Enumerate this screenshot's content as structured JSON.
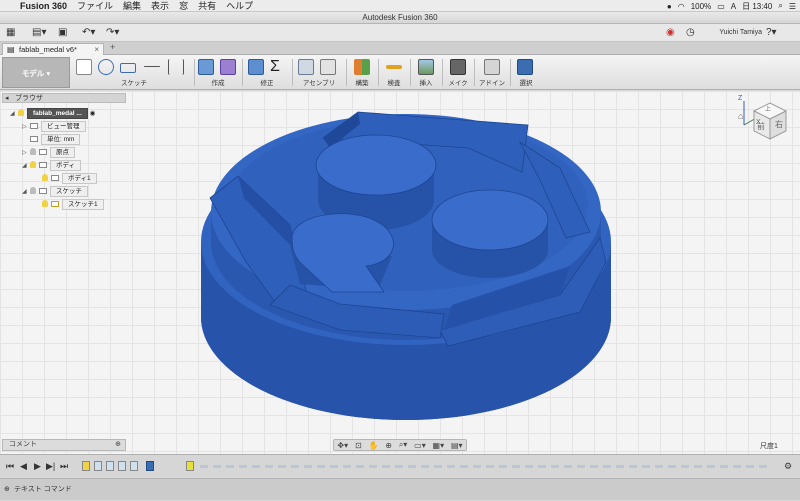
{
  "menubar": {
    "apple": "",
    "app_name": "Fusion 360",
    "items": [
      "ファイル",
      "編集",
      "表示",
      "窓",
      "共有",
      "ヘルプ"
    ],
    "battery": "100%",
    "ime": "A",
    "clock": "日 13:40"
  },
  "window": {
    "title": "Autodesk Fusion 360"
  },
  "qat": {
    "user": "Yuichi Tamiya"
  },
  "doc_tab": {
    "name": "fablab_medal v6*",
    "close": "×"
  },
  "ribbon": {
    "workspace": "モデル",
    "groups": [
      "スケッチ",
      "作成",
      "修正",
      "アセンブリ",
      "構築",
      "検査",
      "挿入",
      "メイク",
      "アドイン",
      "選択"
    ]
  },
  "browser": {
    "title": "ブラウザ",
    "root": "fablab_medal ...",
    "items": [
      "ビュー管理",
      "単位: mm",
      "原点",
      "ボディ",
      "ボディ1",
      "スケッチ",
      "スケッチ1"
    ]
  },
  "viewcube": {
    "left": "前",
    "right": "右",
    "top": "上",
    "axis_x": "X",
    "axis_z": "Z"
  },
  "comment_bar": {
    "label": "コメント"
  },
  "scale": {
    "label": "尺度1"
  },
  "textcmd": {
    "label": "テキスト コマンド"
  },
  "colors": {
    "body": "#2f5fb8",
    "body_dark": "#1f4696",
    "ribbon_accent": "#3b6db3"
  }
}
